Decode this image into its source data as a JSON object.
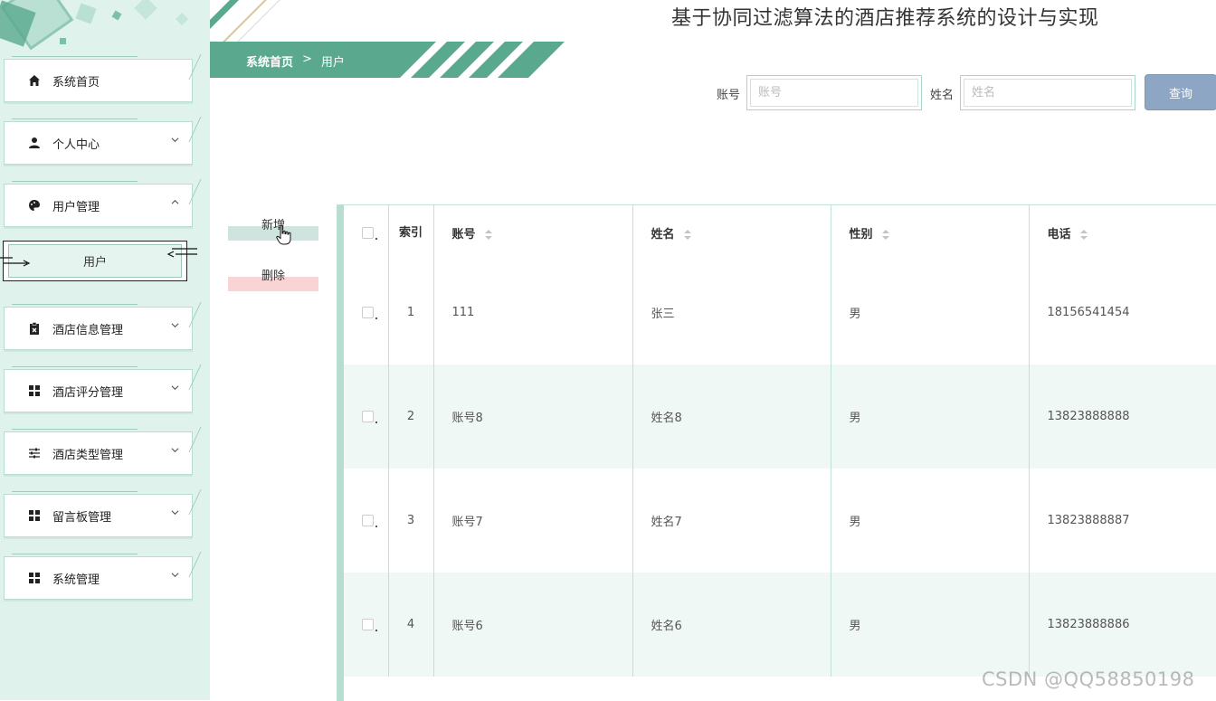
{
  "app": {
    "title": "基于协同过滤算法的酒店推荐系统的设计与实现"
  },
  "breadcrumb": {
    "home": "系统首页",
    "separator": ">",
    "current": "用户"
  },
  "sidebar": {
    "items": [
      {
        "label": "系统首页",
        "icon": "home-icon",
        "has_chevron": false
      },
      {
        "label": "个人中心",
        "icon": "person-icon",
        "has_chevron": true
      },
      {
        "label": "用户管理",
        "icon": "palette-icon",
        "has_chevron": true,
        "expanded": true
      },
      {
        "label": "酒店信息管理",
        "icon": "clipboard-x-icon",
        "has_chevron": true
      },
      {
        "label": "酒店评分管理",
        "icon": "grid-icon",
        "has_chevron": true
      },
      {
        "label": "酒店类型管理",
        "icon": "sliders-icon",
        "has_chevron": true
      },
      {
        "label": "留言板管理",
        "icon": "grid-icon",
        "has_chevron": true
      },
      {
        "label": "系统管理",
        "icon": "grid-icon",
        "has_chevron": true
      }
    ],
    "submenu": {
      "label": "用户"
    }
  },
  "search": {
    "account_label": "账号",
    "account_placeholder": "账号",
    "account_value": "",
    "name_label": "姓名",
    "name_placeholder": "姓名",
    "name_value": "",
    "query_button": "查询"
  },
  "actions": {
    "add_label": "新增",
    "delete_label": "删除"
  },
  "table": {
    "headers": {
      "index": "索引",
      "account": "账号",
      "name": "姓名",
      "sex": "性别",
      "phone": "电话"
    },
    "rows": [
      {
        "index": "1",
        "account": "111",
        "name": "张三",
        "sex": "男",
        "phone": "18156541454"
      },
      {
        "index": "2",
        "account": "账号8",
        "name": "姓名8",
        "sex": "男",
        "phone": "13823888888"
      },
      {
        "index": "3",
        "account": "账号7",
        "name": "姓名7",
        "sex": "男",
        "phone": "13823888887"
      },
      {
        "index": "4",
        "account": "账号6",
        "name": "姓名6",
        "sex": "男",
        "phone": "13823888886"
      }
    ]
  },
  "watermark": "CSDN @QQ58850198",
  "colors": {
    "sidebar_bg": "#dff3ec",
    "accent_green": "#5aa98f",
    "query_button": "#8ca6c3",
    "row_alt": "#eff8f5"
  }
}
